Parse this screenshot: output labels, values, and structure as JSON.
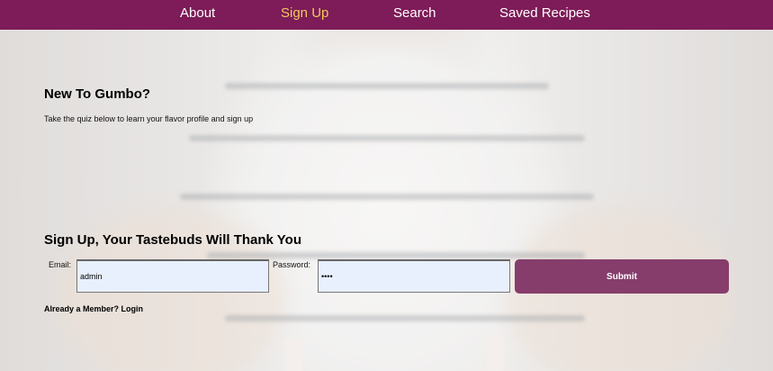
{
  "nav": {
    "items": [
      {
        "label": "About",
        "active": false
      },
      {
        "label": "Sign Up",
        "active": true
      },
      {
        "label": "Search",
        "active": false
      },
      {
        "label": "Saved Recipes",
        "active": false
      }
    ],
    "background_color": "#7d1c58",
    "active_color": "#f3c95f"
  },
  "intro": {
    "title": "New To Gumbo?",
    "subtitle": "Take the quiz below to learn your flavor profile and sign up"
  },
  "signup": {
    "title": "Sign Up, Your Tastebuds Will Thank You",
    "email_label": "Email:",
    "email_value": "admin",
    "password_label": "Password:",
    "password_value": "••••",
    "submit_label": "Submit",
    "submit_color": "#863d6c",
    "login_link": "Already a Member? Login"
  }
}
